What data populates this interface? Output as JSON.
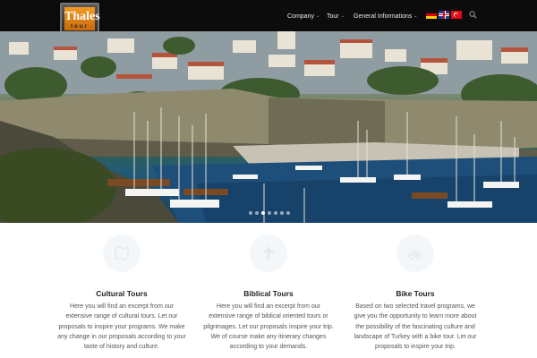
{
  "brand": {
    "logo_text": "Thales",
    "logo_subtext": "tour"
  },
  "nav": {
    "items": [
      {
        "label": "Company",
        "has_dropdown": true
      },
      {
        "label": "Tour",
        "has_dropdown": true
      },
      {
        "label": "General Informations",
        "has_dropdown": true
      }
    ],
    "chevron": "⌄"
  },
  "languages": [
    {
      "code": "de",
      "icon": "german-flag-icon"
    },
    {
      "code": "en",
      "icon": "uk-flag-icon"
    },
    {
      "code": "tr",
      "icon": "turkish-flag-icon"
    }
  ],
  "hero": {
    "image": "harbor-photo (Antalya old town harbor with sailing boats)",
    "slide_count": 7,
    "active_slide": 2
  },
  "features": [
    {
      "icon": "map-icon",
      "title": "Cultural Tours",
      "text": "Here you will find an excerpt from our extensive range of cultural tours. Let our proposals to inspire your programs. We make any change in our proposals according to your taste of history and culture."
    },
    {
      "icon": "cross-icon",
      "title": "Biblical Tours",
      "text": "Here you will find an excerpt from our extensive range of biblical oriented tours or pilgrimages. Let our proposals inspire your trip. We of course make any itinerary changes according to your demands."
    },
    {
      "icon": "bike-icon",
      "title": "Bike Tours",
      "text": "Based on two selected travel programs, we give you the opportunity to learn more about the possibility of the fascinating culture and landscape of Turkey with a bike tour. Let our proposals to inspire your trip."
    }
  ],
  "colors": {
    "header_bg": "#0c0c0c",
    "logo_orange": "#f39a22",
    "icon_circle_bg": "#f4f7fa"
  }
}
